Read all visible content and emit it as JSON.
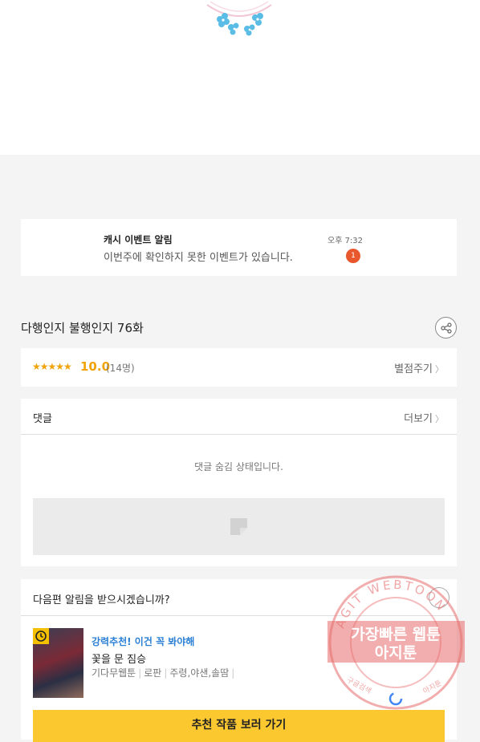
{
  "notice": {
    "title": "캐시 이벤트 알림",
    "text": "이번주에 확인하지 못한 이벤트가 있습니다.",
    "time": "오후 7:32",
    "badge": "1"
  },
  "episode": {
    "title": "다행인지 불행인지 76화"
  },
  "rating": {
    "stars": "★★★★★",
    "score": "10.0",
    "count": "(14명)",
    "rate_link": "별점주기"
  },
  "comments": {
    "heading": "댓글",
    "more": "더보기",
    "hidden_text": "댓글 숨김 상태입니다."
  },
  "next": {
    "question": "다음편 알림을 받으시겠습니까?",
    "rec_title": "강력추천! 이건 꼭 봐야해",
    "rec_name": "꽃을 문 짐승",
    "rec_meta": [
      "기다무웹툰",
      "로판",
      "주령,야샌,솔땀"
    ],
    "cta": "추천 작품 보러 가기"
  },
  "watermark": {
    "ring_text": "AGIT WEBTOON",
    "line1": "가장빠른 웹툰",
    "line2": "아지툰",
    "small_left": "구글검색",
    "small_right": "아지툰"
  },
  "colors": {
    "accent": "#f0a30a",
    "badge": "#e8582c",
    "link_blue": "#2a7fd4",
    "cta": "#fbc830",
    "stamp": "#e86c6c"
  }
}
